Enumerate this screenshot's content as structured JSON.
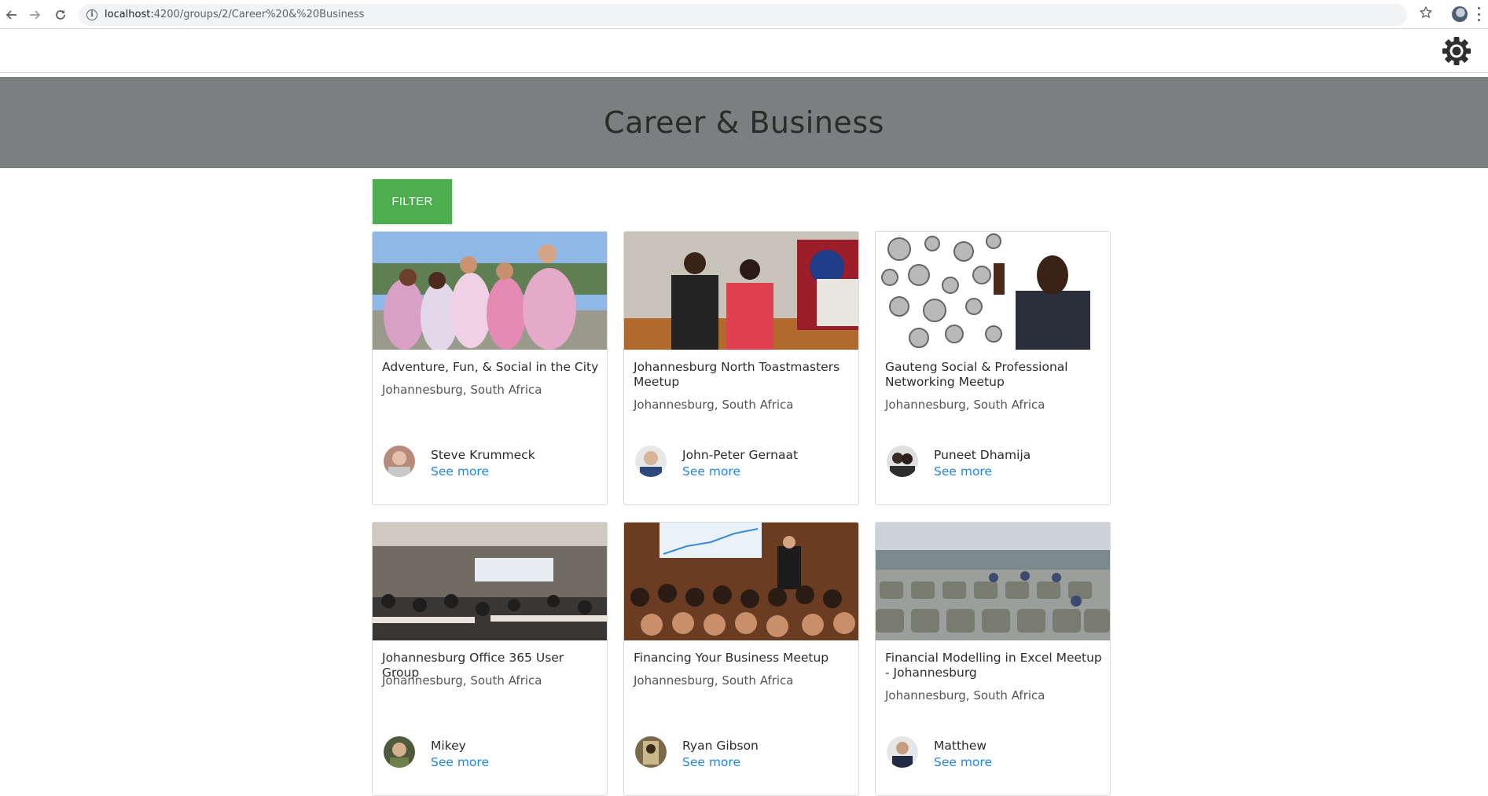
{
  "browser": {
    "url_host": "localhost:",
    "url_path": "4200/groups/2/Career%20&%20Business"
  },
  "page": {
    "title": "Career & Business",
    "filter_label": "FILTER"
  },
  "groups": [
    {
      "title": "Adventure, Fun, & Social in the City",
      "location": "Johannesburg, South Africa",
      "organizer": "Steve Krummeck",
      "see_more": "See more"
    },
    {
      "title": "Johannesburg North Toastmasters Meetup",
      "location": "Johannesburg, South Africa",
      "organizer": "John-Peter Gernaat",
      "see_more": "See more"
    },
    {
      "title": "Gauteng Social & Professional Networking Meetup",
      "location": "Johannesburg, South Africa",
      "organizer": "Puneet Dhamija",
      "see_more": "See more"
    },
    {
      "title": "Johannesburg Office 365 User Group",
      "location": "Johannesburg, South Africa",
      "organizer": "Mikey",
      "see_more": "See more"
    },
    {
      "title": "Financing Your Business Meetup",
      "location": "Johannesburg, South Africa",
      "organizer": "Ryan Gibson",
      "see_more": "See more"
    },
    {
      "title": "Financial Modelling in Excel Meetup - Johannesburg",
      "location": "Johannesburg, South Africa",
      "organizer": "Matthew",
      "see_more": "See more"
    }
  ],
  "colors": {
    "hero_bg": "#7b7f80",
    "filter_bg": "#4cae4c",
    "link": "#1e88e5"
  }
}
